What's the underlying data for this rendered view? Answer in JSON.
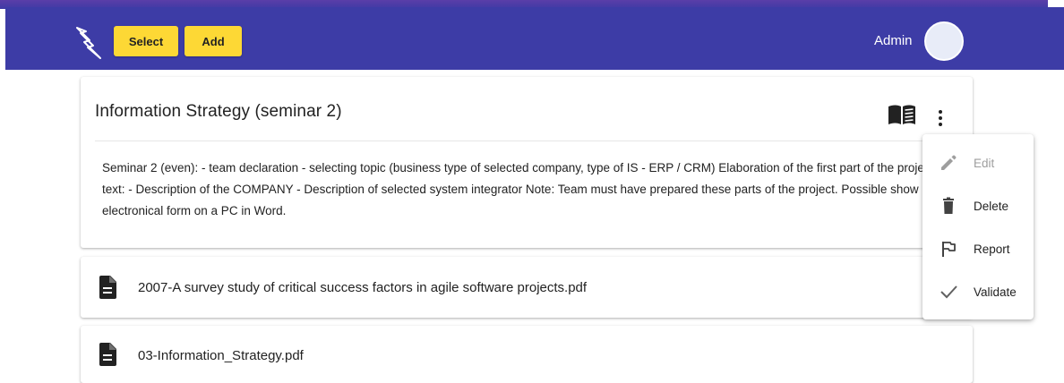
{
  "appbar": {
    "logo_icon": "lightning-icon",
    "select_label": "Select",
    "add_label": "Add",
    "user_label": "Admin",
    "bar_color": "#3d3ca6",
    "button_color": "#fdd835"
  },
  "card": {
    "title": "Information Strategy (seminar 2)",
    "book_icon": "book-open-icon",
    "more_icon": "more-vert-icon",
    "description": "Seminar 2 (even): - team declaration - selecting topic (business type of selected company, type of IS - ERP / CRM) Elaboration of the first part of the project text: - Description of the COMPANY - Description of selected system integrator Note: Team must have prepared these parts of the project. Possible show in electronical form on a PC in Word."
  },
  "files": [
    {
      "name": "2007-A survey study of critical success factors in agile software projects.pdf",
      "icon": "file-document-icon"
    },
    {
      "name": "03-Information_Strategy.pdf",
      "icon": "file-document-icon"
    }
  ],
  "menu": {
    "items": [
      {
        "label": "Edit",
        "icon": "pencil-icon",
        "disabled": true
      },
      {
        "label": "Delete",
        "icon": "trash-icon",
        "disabled": false
      },
      {
        "label": "Report",
        "icon": "flag-icon",
        "disabled": false
      },
      {
        "label": "Validate",
        "icon": "check-icon",
        "disabled": false
      }
    ]
  }
}
